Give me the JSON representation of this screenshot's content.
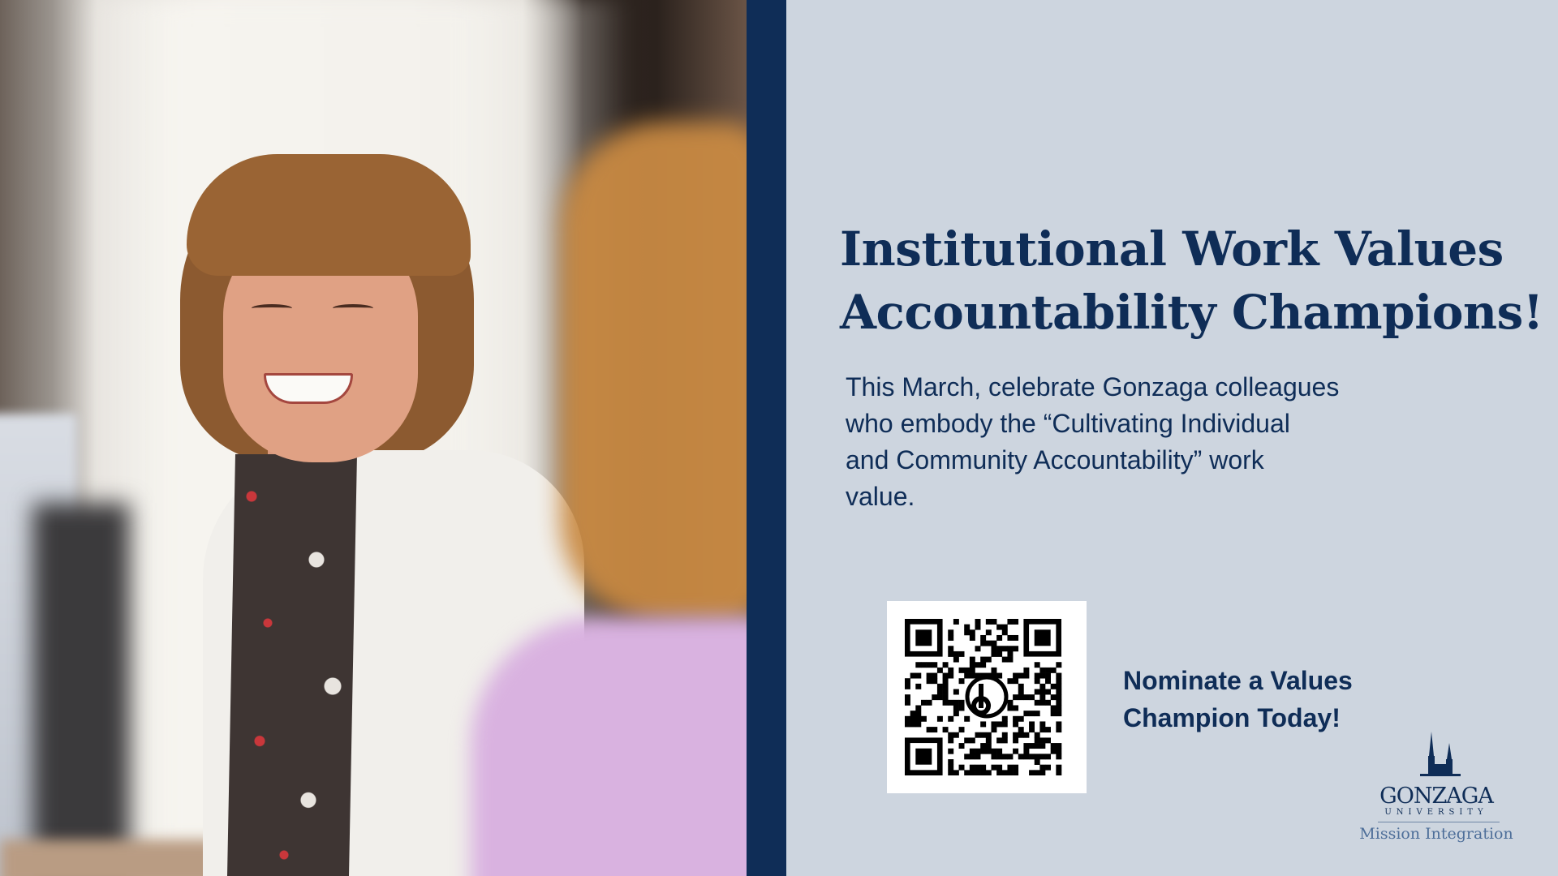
{
  "headline": {
    "line1": "Institutional Work Values",
    "line2": "Accountability Champions!"
  },
  "body": {
    "line1": "This March, celebrate Gonzaga colleagues",
    "line2": "who embody the “Cultivating Individual",
    "line3": "and Community Accountability” work",
    "line4": "value."
  },
  "cta": {
    "line1": "Nominate a Values",
    "line2": "Champion Today!"
  },
  "logo": {
    "wordmark": "GONZAGA",
    "university": "UNIVERSITY",
    "department": "Mission Integration"
  },
  "colors": {
    "navy": "#0f2d57",
    "panel": "#cdd5df",
    "logo_sub": "#4d6e99"
  },
  "icons": {
    "qr": "qr-code-icon",
    "spires": "church-spires-icon"
  }
}
